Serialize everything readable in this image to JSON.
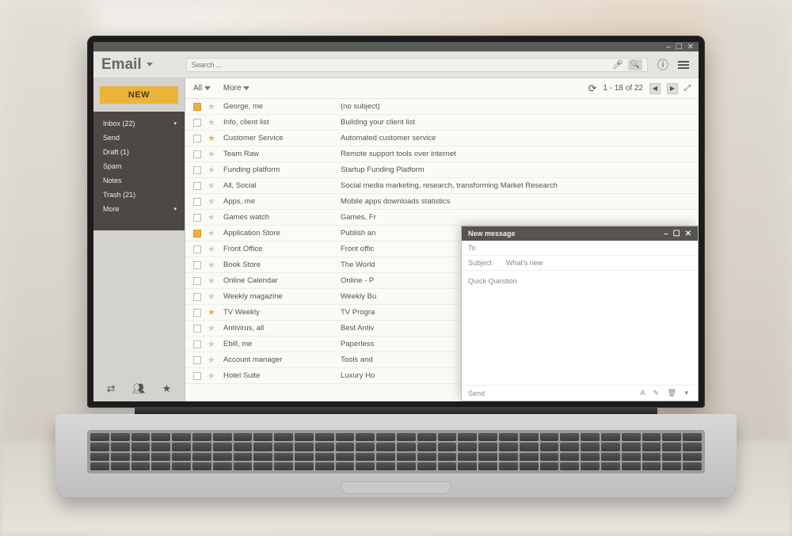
{
  "window_controls": {
    "min": "–",
    "max": "☐",
    "close": "✕"
  },
  "app": {
    "title": "Email"
  },
  "search": {
    "placeholder": "Search ..."
  },
  "sidebar": {
    "new_label": "NEW",
    "folders": [
      {
        "label": "Inbox (22)"
      },
      {
        "label": "Send"
      },
      {
        "label": "Draft (1)"
      },
      {
        "label": "Spam"
      },
      {
        "label": "Notes"
      },
      {
        "label": "Trash (21)"
      },
      {
        "label": "More"
      }
    ]
  },
  "toolbar": {
    "all": "All",
    "more": "More",
    "pagination": "1 - 18 of 22"
  },
  "mails": [
    {
      "chk": true,
      "star": false,
      "sender": "George, me",
      "subject": "(no subject)"
    },
    {
      "chk": false,
      "star": false,
      "sender": "Info, client list",
      "subject": "Building your client list"
    },
    {
      "chk": false,
      "star": true,
      "sender": "Customer Service",
      "subject": "Automated customer service"
    },
    {
      "chk": false,
      "star": false,
      "sender": "Team Raw",
      "subject": "Remote support tools over internet"
    },
    {
      "chk": false,
      "star": false,
      "sender": "Funding platform",
      "subject": "Startup Funding Platform"
    },
    {
      "chk": false,
      "star": false,
      "sender": "All, Social",
      "subject": "Social media marketing, research, transforming Market Research"
    },
    {
      "chk": false,
      "star": false,
      "sender": "Apps, me",
      "subject": "Mobile apps downloads statistics"
    },
    {
      "chk": false,
      "star": false,
      "sender": "Games watch",
      "subject": "Games, Fr"
    },
    {
      "chk": true,
      "star": false,
      "sender": "Application Store",
      "subject": "Publish an"
    },
    {
      "chk": false,
      "star": false,
      "sender": "Front Office",
      "subject": "Front offic"
    },
    {
      "chk": false,
      "star": false,
      "sender": "Book Store",
      "subject": "The World"
    },
    {
      "chk": false,
      "star": false,
      "sender": "Online Calendar",
      "subject": "Online - P"
    },
    {
      "chk": false,
      "star": false,
      "sender": "Weekly magazine",
      "subject": "Weekly Bu"
    },
    {
      "chk": false,
      "star": true,
      "sender": "TV Weekly",
      "subject": "TV Progra"
    },
    {
      "chk": false,
      "star": false,
      "sender": "Antivirus, all",
      "subject": "Best Antiv"
    },
    {
      "chk": false,
      "star": false,
      "sender": "Ebill, me",
      "subject": "Paperless"
    },
    {
      "chk": false,
      "star": false,
      "sender": "Account manager",
      "subject": "Tools and"
    },
    {
      "chk": false,
      "star": false,
      "sender": "Hotel Suite",
      "subject": "Luxury Ho"
    }
  ],
  "compose": {
    "title": "New message",
    "to_label": "To",
    "subject_label": "Subject",
    "whatsnew": "What's new",
    "body_placeholder": "Quick Question",
    "send_label": "Send"
  }
}
